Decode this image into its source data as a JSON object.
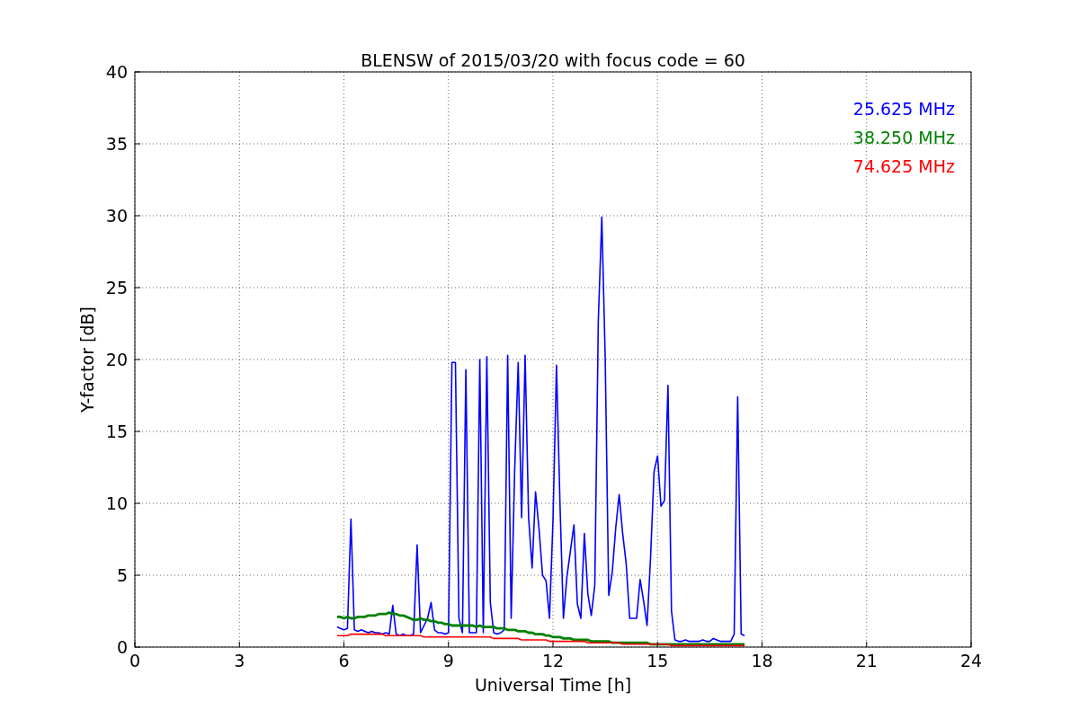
{
  "figure": {
    "chart_data": {
      "type": "line",
      "title": "BLENSW of 2015/03/20 with focus code = 60",
      "xlabel": "Universal Time [h]",
      "ylabel": "Y-factor [dB]",
      "xlim": [
        0,
        24
      ],
      "ylim": [
        0,
        40
      ],
      "grid": true,
      "xticks": [
        0,
        3,
        6,
        9,
        12,
        15,
        18,
        21,
        24
      ],
      "yticks": [
        0,
        5,
        10,
        15,
        20,
        25,
        30,
        35,
        40
      ],
      "x": [
        5.8,
        5.9,
        6.0,
        6.1,
        6.2,
        6.3,
        6.4,
        6.5,
        6.6,
        6.7,
        6.8,
        6.9,
        7.0,
        7.1,
        7.2,
        7.3,
        7.4,
        7.5,
        7.6,
        7.7,
        7.8,
        7.9,
        8.0,
        8.1,
        8.2,
        8.3,
        8.4,
        8.5,
        8.6,
        8.7,
        8.8,
        8.9,
        9.0,
        9.1,
        9.2,
        9.3,
        9.4,
        9.5,
        9.6,
        9.7,
        9.8,
        9.9,
        10.0,
        10.1,
        10.2,
        10.3,
        10.4,
        10.5,
        10.6,
        10.7,
        10.8,
        10.9,
        11.0,
        11.1,
        11.2,
        11.3,
        11.4,
        11.5,
        11.6,
        11.7,
        11.8,
        11.9,
        12.0,
        12.1,
        12.2,
        12.3,
        12.4,
        12.5,
        12.6,
        12.7,
        12.8,
        12.9,
        13.0,
        13.1,
        13.2,
        13.3,
        13.4,
        13.5,
        13.6,
        13.7,
        13.8,
        13.9,
        14.0,
        14.1,
        14.2,
        14.3,
        14.4,
        14.5,
        14.6,
        14.7,
        14.8,
        14.9,
        15.0,
        15.1,
        15.2,
        15.3,
        15.4,
        15.5,
        15.6,
        15.7,
        15.8,
        15.9,
        16.0,
        16.1,
        16.2,
        16.3,
        16.4,
        16.5,
        16.6,
        16.7,
        16.8,
        16.9,
        17.0,
        17.1,
        17.2,
        17.3,
        17.4,
        17.5
      ],
      "series": [
        {
          "name": "25.625 MHz",
          "color": "#0000ff",
          "values": [
            1.4,
            1.3,
            1.2,
            1.3,
            8.9,
            1.2,
            1.1,
            1.2,
            1.1,
            1.0,
            1.1,
            1.0,
            1.0,
            0.9,
            1.0,
            0.9,
            2.9,
            0.9,
            0.8,
            0.9,
            0.8,
            0.8,
            0.9,
            7.1,
            1.0,
            1.5,
            2.0,
            3.1,
            1.2,
            1.0,
            1.0,
            0.9,
            1.0,
            19.8,
            19.8,
            2.0,
            1.0,
            19.3,
            1.0,
            1.0,
            1.0,
            20.0,
            1.0,
            20.2,
            3.1,
            1.0,
            0.9,
            1.0,
            1.2,
            20.3,
            2.0,
            12.3,
            19.8,
            9.0,
            20.3,
            9.0,
            5.5,
            10.8,
            8.2,
            5.0,
            4.6,
            2.0,
            8.8,
            19.6,
            9.9,
            2.0,
            4.9,
            6.7,
            8.5,
            3.0,
            2.0,
            7.9,
            3.7,
            2.2,
            4.3,
            22.7,
            29.9,
            20.0,
            3.6,
            5.2,
            8.3,
            10.6,
            7.9,
            5.8,
            2.0,
            2.0,
            2.0,
            4.7,
            3.2,
            1.5,
            6.2,
            12.2,
            13.3,
            9.8,
            10.2,
            18.2,
            2.5,
            0.5,
            0.4,
            0.4,
            0.5,
            0.4,
            0.4,
            0.4,
            0.4,
            0.5,
            0.4,
            0.4,
            0.6,
            0.5,
            0.4,
            0.4,
            0.4,
            0.4,
            0.9,
            17.4,
            0.9,
            0.8
          ]
        },
        {
          "name": "38.250 MHz",
          "color": "#008000",
          "values": [
            2.1,
            2.1,
            2.0,
            2.1,
            2.0,
            2.0,
            2.1,
            2.1,
            2.1,
            2.2,
            2.2,
            2.2,
            2.3,
            2.3,
            2.3,
            2.4,
            2.3,
            2.3,
            2.2,
            2.2,
            2.1,
            2.0,
            1.9,
            1.9,
            2.0,
            1.9,
            1.9,
            1.8,
            1.8,
            1.7,
            1.7,
            1.6,
            1.6,
            1.5,
            1.5,
            1.5,
            1.5,
            1.5,
            1.5,
            1.5,
            1.4,
            1.5,
            1.4,
            1.4,
            1.4,
            1.4,
            1.3,
            1.3,
            1.3,
            1.2,
            1.2,
            1.2,
            1.1,
            1.1,
            1.1,
            1.0,
            1.0,
            0.9,
            0.9,
            0.9,
            0.8,
            0.8,
            0.7,
            0.7,
            0.7,
            0.6,
            0.6,
            0.6,
            0.5,
            0.5,
            0.5,
            0.5,
            0.5,
            0.4,
            0.4,
            0.4,
            0.4,
            0.4,
            0.4,
            0.3,
            0.3,
            0.3,
            0.3,
            0.3,
            0.3,
            0.3,
            0.3,
            0.3,
            0.3,
            0.3,
            0.2,
            0.2,
            0.2,
            0.2,
            0.2,
            0.2,
            0.2,
            0.2,
            0.2,
            0.2,
            0.2,
            0.2,
            0.2,
            0.2,
            0.2,
            0.2,
            0.2,
            0.2,
            0.2,
            0.2,
            0.2,
            0.2,
            0.2,
            0.2,
            0.2,
            0.2,
            0.2,
            0.2
          ]
        },
        {
          "name": "74.625 MHz",
          "color": "#ff0000",
          "values": [
            0.8,
            0.8,
            0.8,
            0.8,
            0.9,
            0.9,
            0.9,
            0.9,
            0.9,
            0.9,
            0.9,
            0.9,
            0.9,
            0.9,
            0.8,
            0.8,
            0.8,
            0.8,
            0.8,
            0.8,
            0.8,
            0.8,
            0.8,
            0.8,
            0.8,
            0.7,
            0.7,
            0.7,
            0.7,
            0.7,
            0.7,
            0.7,
            0.7,
            0.7,
            0.7,
            0.7,
            0.7,
            0.7,
            0.7,
            0.7,
            0.7,
            0.7,
            0.7,
            0.7,
            0.7,
            0.6,
            0.6,
            0.6,
            0.6,
            0.6,
            0.6,
            0.6,
            0.6,
            0.5,
            0.5,
            0.5,
            0.5,
            0.5,
            0.5,
            0.5,
            0.5,
            0.4,
            0.4,
            0.4,
            0.4,
            0.4,
            0.4,
            0.4,
            0.4,
            0.4,
            0.4,
            0.4,
            0.3,
            0.3,
            0.3,
            0.3,
            0.3,
            0.3,
            0.3,
            0.3,
            0.3,
            0.3,
            0.2,
            0.2,
            0.2,
            0.2,
            0.2,
            0.2,
            0.2,
            0.2,
            0.2,
            0.2,
            0.2,
            0.2,
            0.2,
            0.2,
            0.1,
            0.1,
            0.1,
            0.1,
            0.1,
            0.1,
            0.1,
            0.1,
            0.1,
            0.1,
            0.1,
            0.1,
            0.1,
            0.1,
            0.1,
            0.1,
            0.1,
            0.1,
            0.1,
            0.1,
            0.1,
            0.1
          ]
        }
      ]
    }
  }
}
